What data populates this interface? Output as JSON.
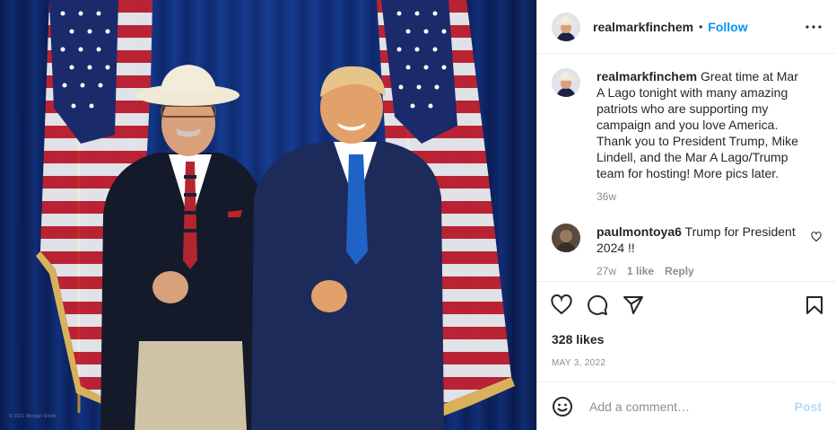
{
  "post": {
    "username": "realmarkfinchem",
    "follow_label": "Follow",
    "separator": "•",
    "photo_watermark": "© 2021 Morgan Smith",
    "caption": {
      "username": "realmarkfinchem",
      "text": "Great time at Mar A Lago tonight with many amazing patriots who are supporting my campaign and you love America. Thank you to President Trump, Mike Lindell, and the Mar A Lago/Trump team for hosting! More pics later.",
      "age": "36w"
    },
    "comments": [
      {
        "username": "paulmontoya6",
        "text": "Trump for President 2024 !!",
        "age": "27w",
        "likes": "1 like",
        "reply_label": "Reply"
      }
    ],
    "likes": "328 likes",
    "date": "MAY 3, 2022",
    "add_comment": {
      "placeholder": "Add a comment…",
      "post_label": "Post"
    }
  },
  "icons": {
    "more": "more-options-icon",
    "like": "heart-icon",
    "comment": "comment-icon",
    "share": "share-icon",
    "save": "bookmark-icon",
    "emoji": "emoji-icon",
    "comment_like": "small-heart-icon"
  },
  "colors": {
    "accent": "#0095f6",
    "post_disabled": "#b3dbff",
    "muted": "#8e8e8e",
    "text": "#262626"
  }
}
